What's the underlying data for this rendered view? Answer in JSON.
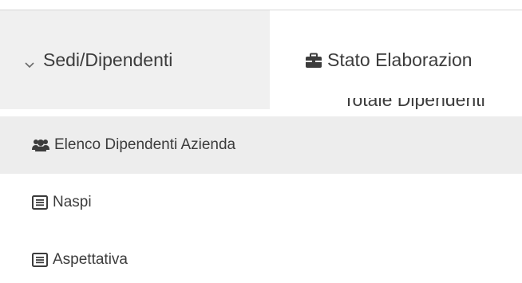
{
  "tabs": [
    {
      "label": "Sedi/Dipendenti",
      "icon": "chevron-down-icon",
      "active": true
    },
    {
      "label": "Stato Elaborazion",
      "icon": "briefcase-icon",
      "active": false
    }
  ],
  "hidden_text": "Totale Dipendenti",
  "dropdown": {
    "items": [
      {
        "label": "Elenco Dipendenti Azienda",
        "icon": "users-icon",
        "highlighted": true
      },
      {
        "label": "Naspi",
        "icon": "list-alt-icon",
        "highlighted": false
      },
      {
        "label": "Aspettativa",
        "icon": "list-alt-icon",
        "highlighted": false
      }
    ]
  },
  "colors": {
    "text": "#3c3c3c",
    "active_tab_bg": "#f0f0f0",
    "highlight_bg": "#ededed"
  }
}
